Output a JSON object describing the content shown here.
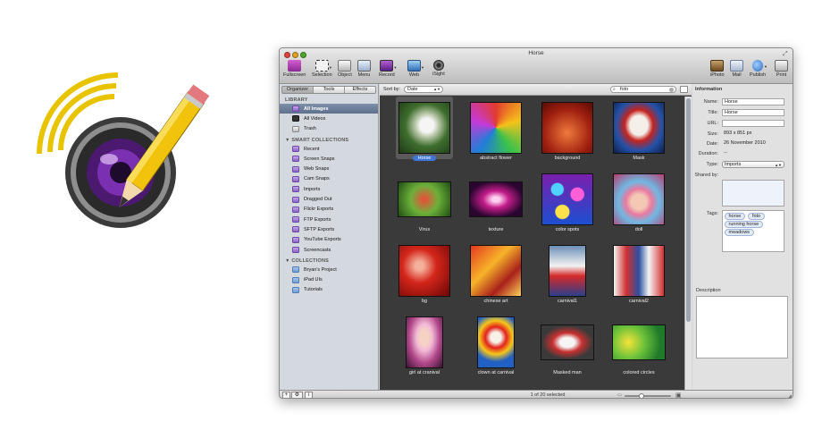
{
  "window": {
    "title": "Horse"
  },
  "toolbar": {
    "left": [
      {
        "label": "Fullscreen",
        "icon": "fullscreen-icon"
      },
      {
        "label": "Selection",
        "icon": "selection-icon"
      },
      {
        "label": "Object",
        "icon": "object-icon"
      },
      {
        "label": "Menu",
        "icon": "menu-icon"
      },
      {
        "label": "Record",
        "icon": "record-icon"
      },
      {
        "label": "Web",
        "icon": "web-icon"
      },
      {
        "label": "iSight",
        "icon": "isight-icon"
      }
    ],
    "right": [
      {
        "label": "iPhoto",
        "icon": "iphoto-icon"
      },
      {
        "label": "Mail",
        "icon": "mail-icon"
      },
      {
        "label": "Publish",
        "icon": "publish-icon"
      },
      {
        "label": "Print",
        "icon": "print-icon"
      }
    ]
  },
  "sidebar": {
    "tabs": [
      "Organizer",
      "Tools",
      "Effects"
    ],
    "active_tab": "Organizer",
    "library_title": "LIBRARY",
    "library_items": [
      "All Images",
      "All Videos",
      "Trash"
    ],
    "smart_title": "SMART COLLECTIONS",
    "smart_items": [
      "Recent",
      "Screen Snaps",
      "Web Snaps",
      "Cam Snaps",
      "Imports",
      "Dragged Out",
      "Flickr Exports",
      "FTP Exports",
      "SFTP Exports",
      "YouTube Exports",
      "Screencasts"
    ],
    "collections_title": "COLLECTIONS",
    "collection_items": [
      "Bryan's Project",
      "iPad UIs",
      "Tutorials"
    ]
  },
  "browser": {
    "sort_label": "Sort by:",
    "sort_value": "Date",
    "search_value": "foto",
    "items": [
      "Horse",
      "abstract flower",
      "background",
      "Mask",
      "Virus",
      "texture",
      "color spots",
      "doll",
      "bg",
      "chinese art",
      "carnival1",
      "carnival2",
      "girl at cranival",
      "clown at carnival",
      "Masked man",
      "colored circles"
    ],
    "selected_index": 0,
    "status": "1 of 20 selected"
  },
  "info": {
    "header": "Information",
    "name_label": "Name:",
    "name_value": "Horse",
    "title_label": "Title:",
    "title_value": "Horse",
    "url_label": "URL:",
    "url_value": "",
    "size_label": "Size:",
    "size_value": "893 x 851 px",
    "date_label": "Date:",
    "date_value": "26 November 2010",
    "duration_label": "Duration:",
    "duration_value": "--",
    "type_label": "Type:",
    "type_value": "Imports",
    "shared_label": "Shared by:",
    "tags_label": "Tags:",
    "tags": [
      "horse",
      "foto",
      "running horse",
      "meadows"
    ],
    "description_label": "Description"
  },
  "bottom": {
    "add_label": "+",
    "info_label": "i"
  },
  "colors": {
    "selection": "#3f77d7",
    "sidebar_bg": "#d4d9df",
    "browser_bg": "#3a3a3a"
  }
}
